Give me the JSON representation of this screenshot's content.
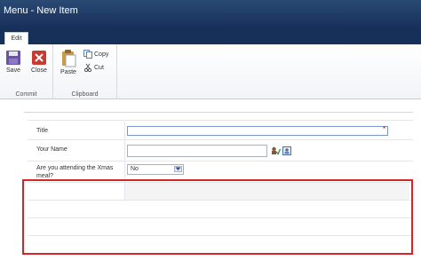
{
  "window": {
    "title": "Menu - New Item"
  },
  "ribbon": {
    "tabs": [
      {
        "label": "Edit"
      }
    ],
    "groups": {
      "commit": {
        "label": "Commit",
        "save": "Save",
        "close": "Close"
      },
      "clipboard": {
        "label": "Clipboard",
        "paste": "Paste",
        "copy": "Copy",
        "cut": "Cut"
      }
    }
  },
  "form": {
    "fields": [
      {
        "label": "Title",
        "value": "",
        "required": "*"
      },
      {
        "label": "Your Name",
        "value": ""
      },
      {
        "label": "Are you attending the Xmas meal?",
        "value": "No"
      }
    ]
  },
  "colors": {
    "titlebar": "#1f3b62",
    "highlight": "#d8232a",
    "accent": "#7a97c7"
  },
  "icons": [
    "save-icon",
    "close-icon",
    "paste-icon",
    "copy-icon",
    "cut-icon",
    "check-names-icon",
    "address-book-icon",
    "chevron-down-icon"
  ]
}
